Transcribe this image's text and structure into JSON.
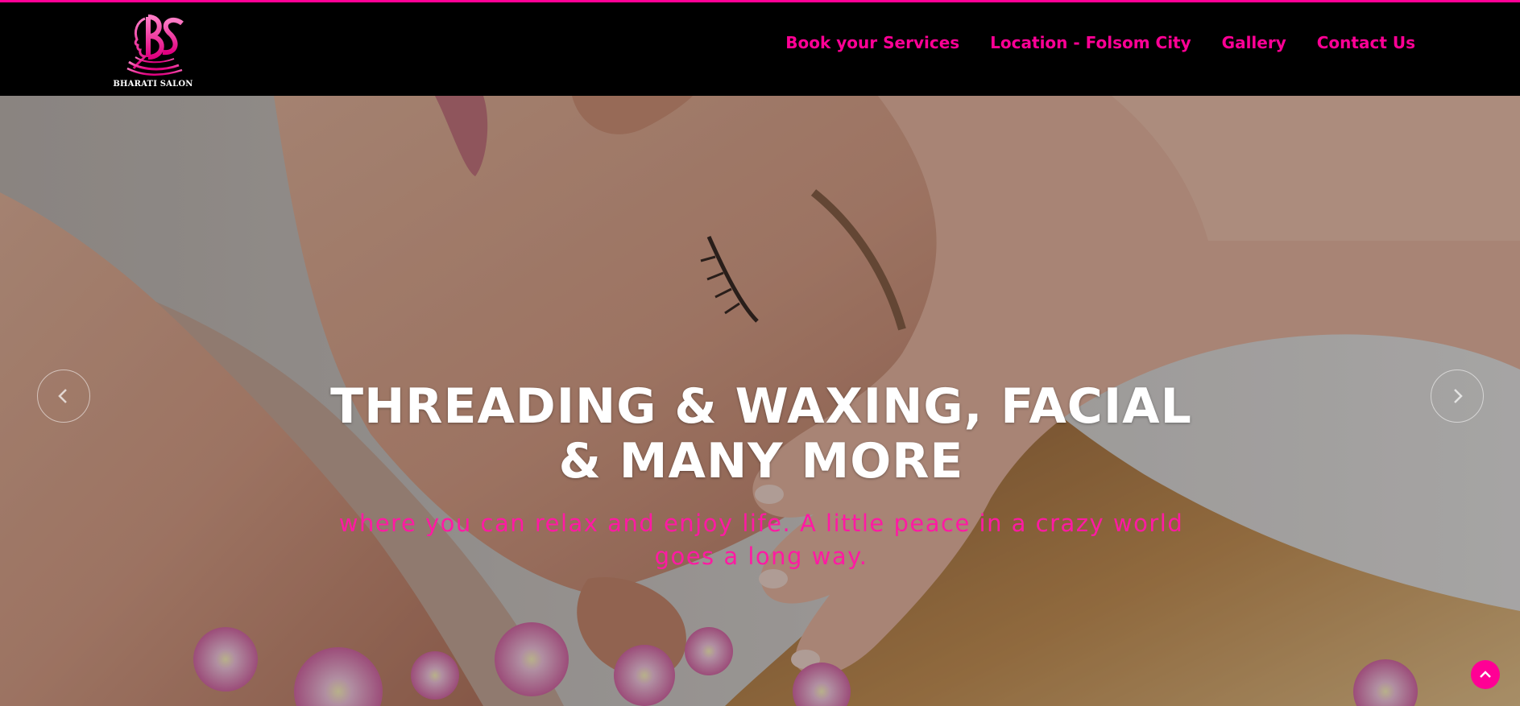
{
  "brand": {
    "name": "BHARATI SALON",
    "monogram": "BS",
    "accent_color": "#ff0095"
  },
  "nav": {
    "items": [
      {
        "label": "Book your Services"
      },
      {
        "label": "Location - Folsom City"
      },
      {
        "label": "Gallery"
      },
      {
        "label": "Contact Us"
      }
    ]
  },
  "hero": {
    "title": "THREADING & WAXING, FACIAL & MANY MORE",
    "subtitle": "where you can relax and enjoy life. A little peace in a crazy world goes a long way.",
    "subtitle_color": "#ff1aa3",
    "prev_icon": "chevron-left-icon",
    "next_icon": "chevron-right-icon"
  },
  "scroll_top": {
    "icon": "chevron-up-icon"
  }
}
